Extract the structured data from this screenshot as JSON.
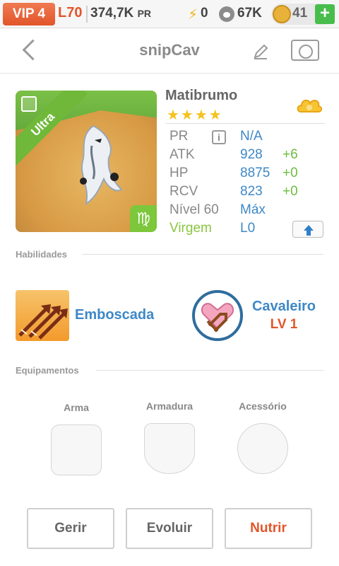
{
  "status_bar": {
    "vip": "VIP 4",
    "level": "L70",
    "power": "374,7K",
    "power_unit": "PR",
    "energy": "0",
    "food": "67K",
    "coins": "41",
    "add": "+",
    "icons": [
      "lightning-icon",
      "paw-icon",
      "coin-icon",
      "plus-icon"
    ]
  },
  "nav": {
    "title": "snipCav",
    "icons": [
      "back-icon",
      "pencil-icon",
      "camera-icon"
    ]
  },
  "monster": {
    "rarity": "Ultra",
    "zodiac_symbol": "♍",
    "name": "Matibrumo",
    "stars": "★★★★",
    "element_icon": "cloud-icon",
    "stats": {
      "pr": {
        "label": "PR",
        "value": "N/A"
      },
      "atk": {
        "label": "ATK",
        "value": "928",
        "bonus": "+6"
      },
      "hp": {
        "label": "HP",
        "value": "8875",
        "bonus": "+0"
      },
      "rcv": {
        "label": "RCV",
        "value": "823",
        "bonus": "+0"
      },
      "level": {
        "label": "Nível 60",
        "value": "Máx"
      },
      "sign": {
        "label": "Virgem",
        "value": "L0"
      }
    }
  },
  "skills": {
    "header": "Habilidades",
    "skill_name": "Emboscada",
    "class_name": "Cavaleiro",
    "class_level": "LV 1"
  },
  "equipment": {
    "header": "Equipamentos",
    "slots": [
      "Arma",
      "Armadura",
      "Acessório"
    ]
  },
  "actions": {
    "manage": "Gerir",
    "evolve": "Evoluir",
    "feed": "Nutrir"
  },
  "colors": {
    "accent_orange": "#e2552a",
    "accent_blue": "#3e88c6",
    "accent_green": "#6cbc3f",
    "star": "#f6c21d"
  }
}
